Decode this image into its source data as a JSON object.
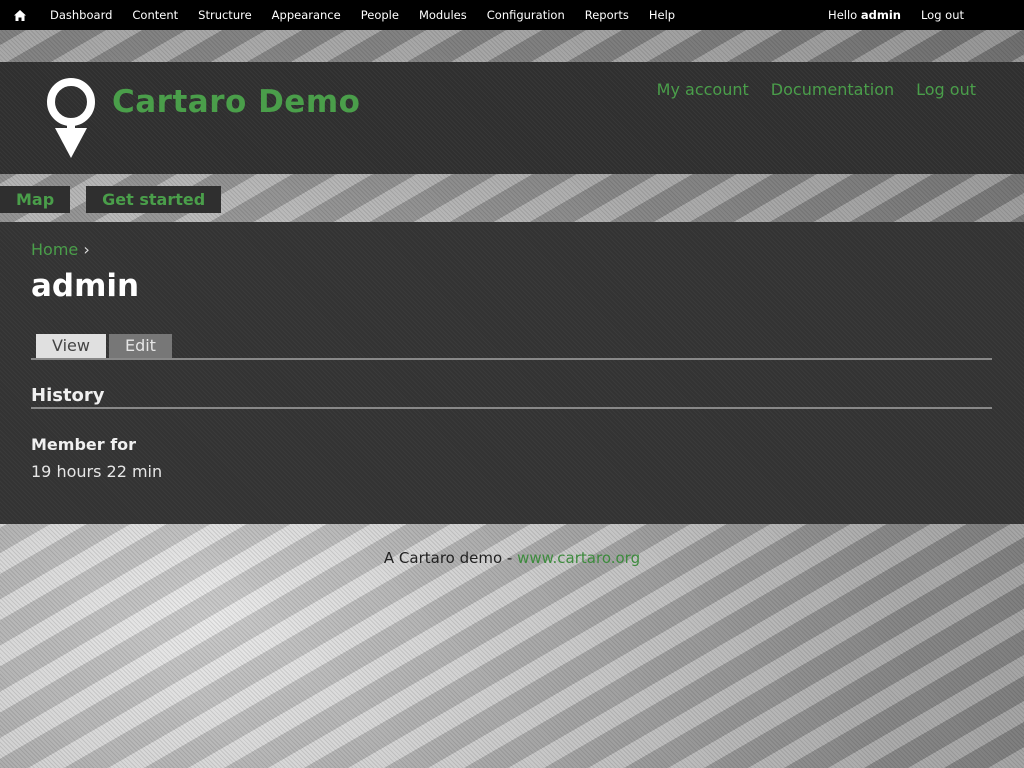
{
  "toolbar": {
    "menu": [
      "Dashboard",
      "Content",
      "Structure",
      "Appearance",
      "People",
      "Modules",
      "Configuration",
      "Reports",
      "Help"
    ],
    "hello": "Hello",
    "username": "admin",
    "logout": "Log out"
  },
  "header": {
    "site_name": "Cartaro Demo",
    "secondary_menu": [
      "My account",
      "Documentation",
      "Log out"
    ]
  },
  "main_menu": [
    "Map",
    "Get started"
  ],
  "content": {
    "breadcrumb_home": "Home",
    "breadcrumb_sep": "›",
    "page_title": "admin",
    "tabs": [
      "View",
      "Edit"
    ],
    "history_title": "History",
    "member_label": "Member for",
    "member_value": "19 hours 22 min"
  },
  "footer": {
    "text": "A Cartaro demo -",
    "link": "www.cartaro.org"
  },
  "colors": {
    "accent": "#4a9e4a",
    "toolbar_bg": "#000000",
    "panel_bg": "#333333"
  }
}
